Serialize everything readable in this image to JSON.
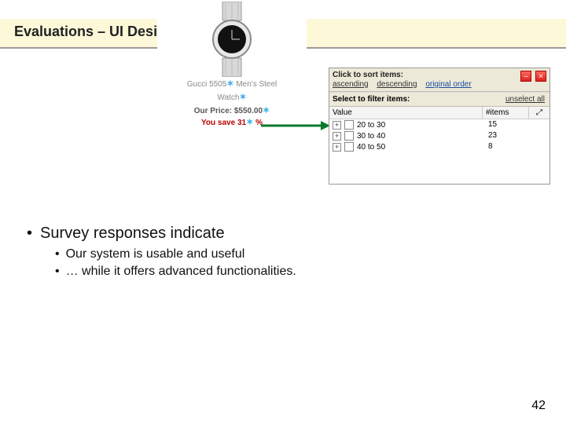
{
  "title": "Evaluations – UI Design",
  "product": {
    "line1": "Gucci 5505",
    "line1b": "Men's Steel",
    "line2": "Watch",
    "price_label": "Our Price:",
    "price_value": "$550.00",
    "save_prefix": "You save",
    "save_value": "31",
    "save_suffix": "%"
  },
  "panel": {
    "sort_title": "Click to sort items:",
    "sort_asc": "ascending",
    "sort_desc": "descending",
    "sort_orig": "original order",
    "filter_title": "Select to filter items:",
    "unselect": "unselect all",
    "col_value": "Value",
    "col_items": "#items",
    "toggle_glyph": "⤢",
    "rows": [
      {
        "label": "20 to 30",
        "count": "15"
      },
      {
        "label": "30 to 40",
        "count": "23"
      },
      {
        "label": "40 to 50",
        "count": "8"
      }
    ]
  },
  "bullets": {
    "b1": "Survey responses indicate",
    "b1_1": "Our system is usable and useful",
    "b1_2": "… while it offers advanced functionalities."
  },
  "page_number": "42"
}
